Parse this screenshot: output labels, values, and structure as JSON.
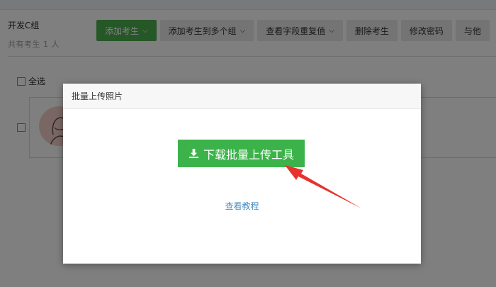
{
  "group": {
    "title": "开发C组",
    "count_text": "共有考生 1 人"
  },
  "toolbar": {
    "buttons": [
      {
        "label": "添加考生",
        "has_dropdown": true
      },
      {
        "label": "添加考生到多个组",
        "has_dropdown": true
      },
      {
        "label": "查看字段重复值",
        "has_dropdown": true
      },
      {
        "label": "删除考生",
        "has_dropdown": false
      },
      {
        "label": "修改密码",
        "has_dropdown": false
      },
      {
        "label": "与他",
        "has_dropdown": false
      }
    ]
  },
  "list": {
    "select_all_label": "全选"
  },
  "modal": {
    "title": "批量上传照片",
    "download_button_label": "下载批量上传工具",
    "tutorial_link": "查看教程"
  },
  "colors": {
    "primary_green": "#3cb34a",
    "link_blue": "#4a90c8",
    "annotation_red": "#e8322d"
  }
}
